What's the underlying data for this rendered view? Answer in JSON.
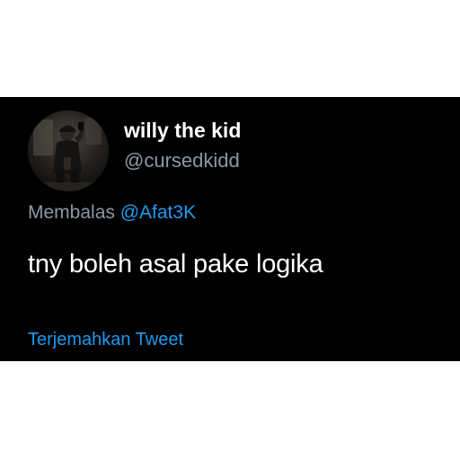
{
  "tweet": {
    "author": {
      "display_name": "willy the kid",
      "handle": "@cursedkidd"
    },
    "reply": {
      "prefix": "Membalas",
      "mention": "@Afat3K"
    },
    "text": "tny boleh asal pake logika",
    "translate_label": "Terjemahkan Tweet"
  },
  "colors": {
    "background": "#000000",
    "page": "#ffffff",
    "text_primary": "#ffffff",
    "text_secondary": "#8b98a5",
    "link": "#1d9bf0"
  },
  "icons": {
    "avatar": "profile-photo-avatar"
  }
}
